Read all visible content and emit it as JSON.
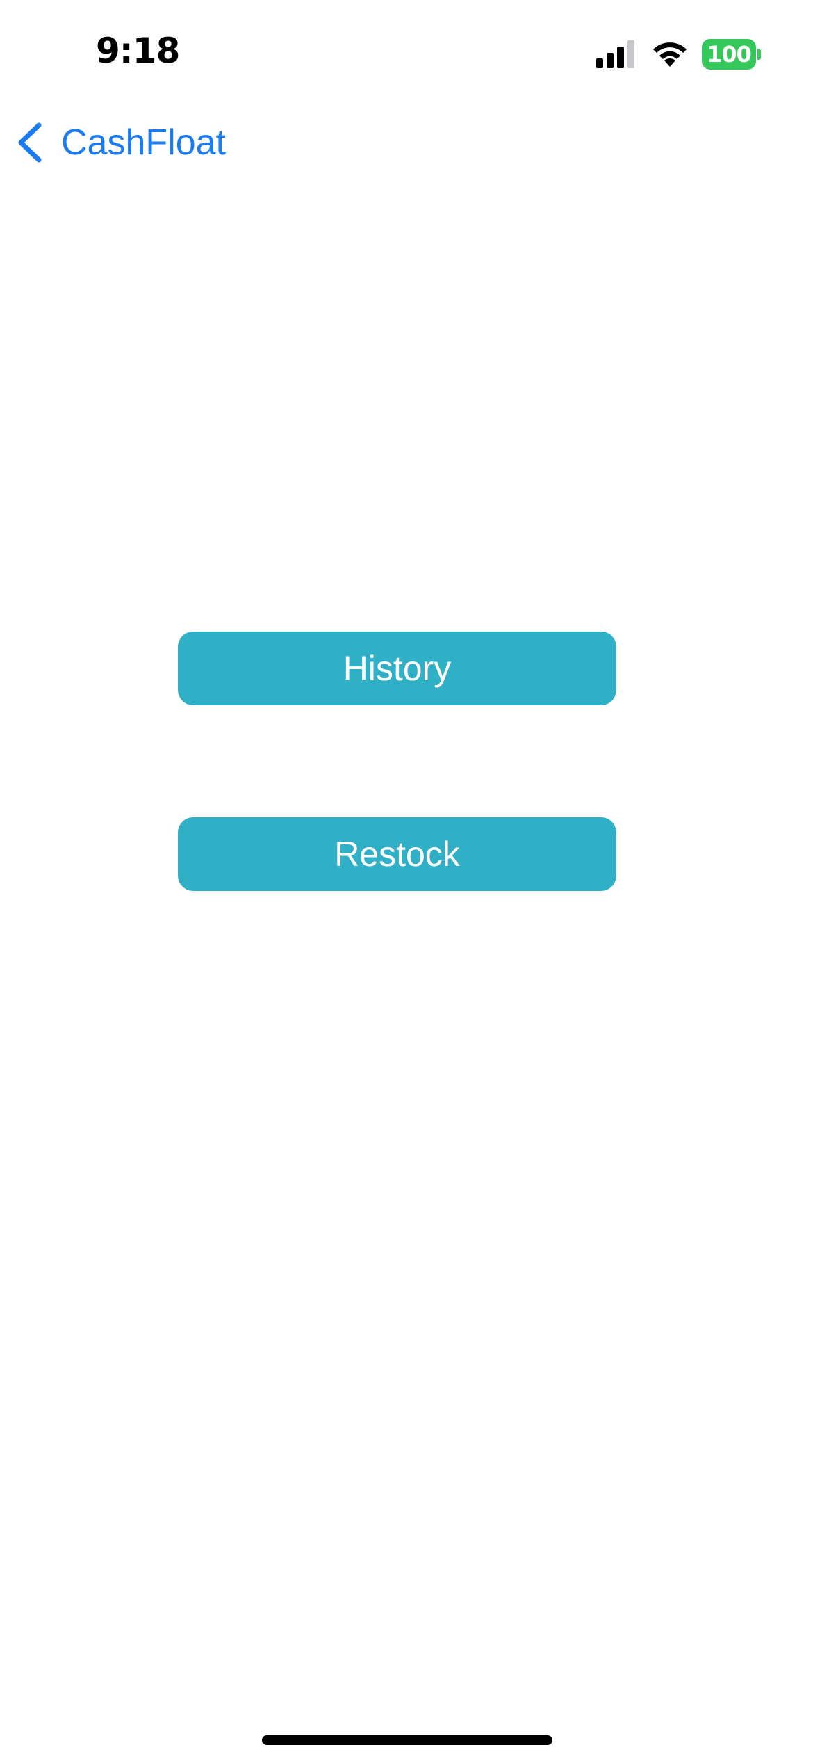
{
  "status_bar": {
    "time": "9:18",
    "battery_level": "100",
    "icons": [
      "signal-icon",
      "wifi-icon",
      "battery-icon"
    ],
    "battery_color": "#35c759"
  },
  "nav": {
    "back_label": "CashFloat",
    "back_icon": "chevron-left-icon",
    "accent_color": "#1a7bf2"
  },
  "main": {
    "buttons": [
      {
        "label": "History"
      },
      {
        "label": "Restock"
      }
    ],
    "button_color": "#30b0c7"
  }
}
